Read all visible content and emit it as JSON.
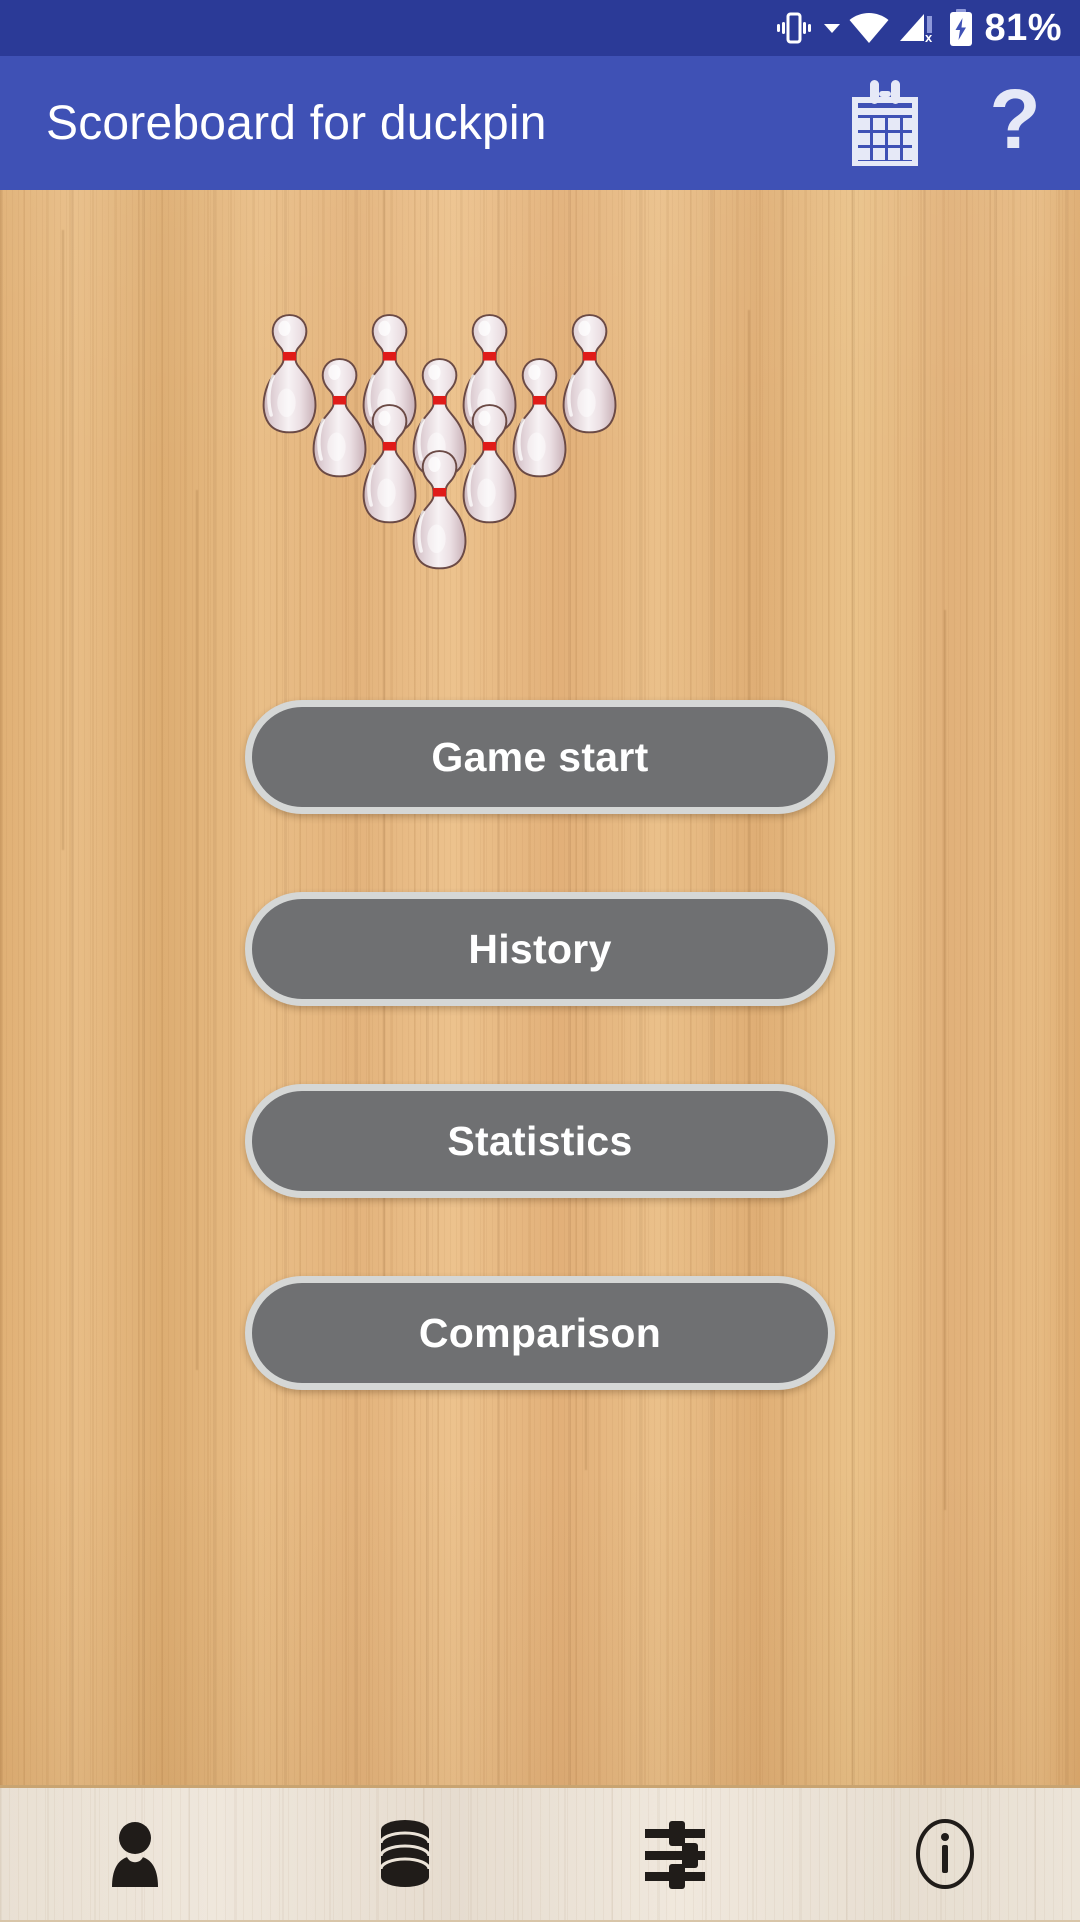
{
  "status_bar": {
    "battery_percent": "81%",
    "icons": [
      {
        "name": "vibrate-icon"
      },
      {
        "name": "dropdown-caret-icon"
      },
      {
        "name": "wifi-icon"
      },
      {
        "name": "mobile-signal-off-icon"
      },
      {
        "name": "battery-charging-icon"
      }
    ],
    "background_color": "#2b3a97",
    "foreground_color": "#ffffff"
  },
  "app_bar": {
    "title": "Scoreboard for duckpin",
    "background_color": "#3f51b5",
    "title_color": "#ffffff",
    "actions": [
      {
        "name": "scoresheet-grid-icon",
        "label": ""
      },
      {
        "name": "help-question-icon",
        "label": "?"
      }
    ],
    "help_glyph": "?"
  },
  "hero": {
    "name": "bowling-pin-rack",
    "pin_count": 10,
    "rows": [
      4,
      3,
      2,
      1
    ],
    "pin_body_color": "#ece2e6",
    "pin_stripe_color": "#e02020",
    "pin_outline_color": "#6b4a45"
  },
  "lane": {
    "background_color": "#e4b47c",
    "grain": "vertical wood grain"
  },
  "menu": {
    "buttons": [
      {
        "name": "game-start-button",
        "label": "Game start"
      },
      {
        "name": "history-button",
        "label": "History"
      },
      {
        "name": "statistics-button",
        "label": "Statistics"
      },
      {
        "name": "comparison-button",
        "label": "Comparison"
      }
    ],
    "button_fill_color": "#6f7072",
    "button_border_color": "#d5d7d6",
    "button_text_color": "#ffffff"
  },
  "bottom_nav": {
    "background_color": "#ece4d8",
    "icon_color": "#201c19",
    "items": [
      {
        "name": "nav-player-icon",
        "label": ""
      },
      {
        "name": "nav-database-icon",
        "label": ""
      },
      {
        "name": "nav-settings-sliders-icon",
        "label": ""
      },
      {
        "name": "nav-info-icon",
        "label": ""
      }
    ]
  }
}
